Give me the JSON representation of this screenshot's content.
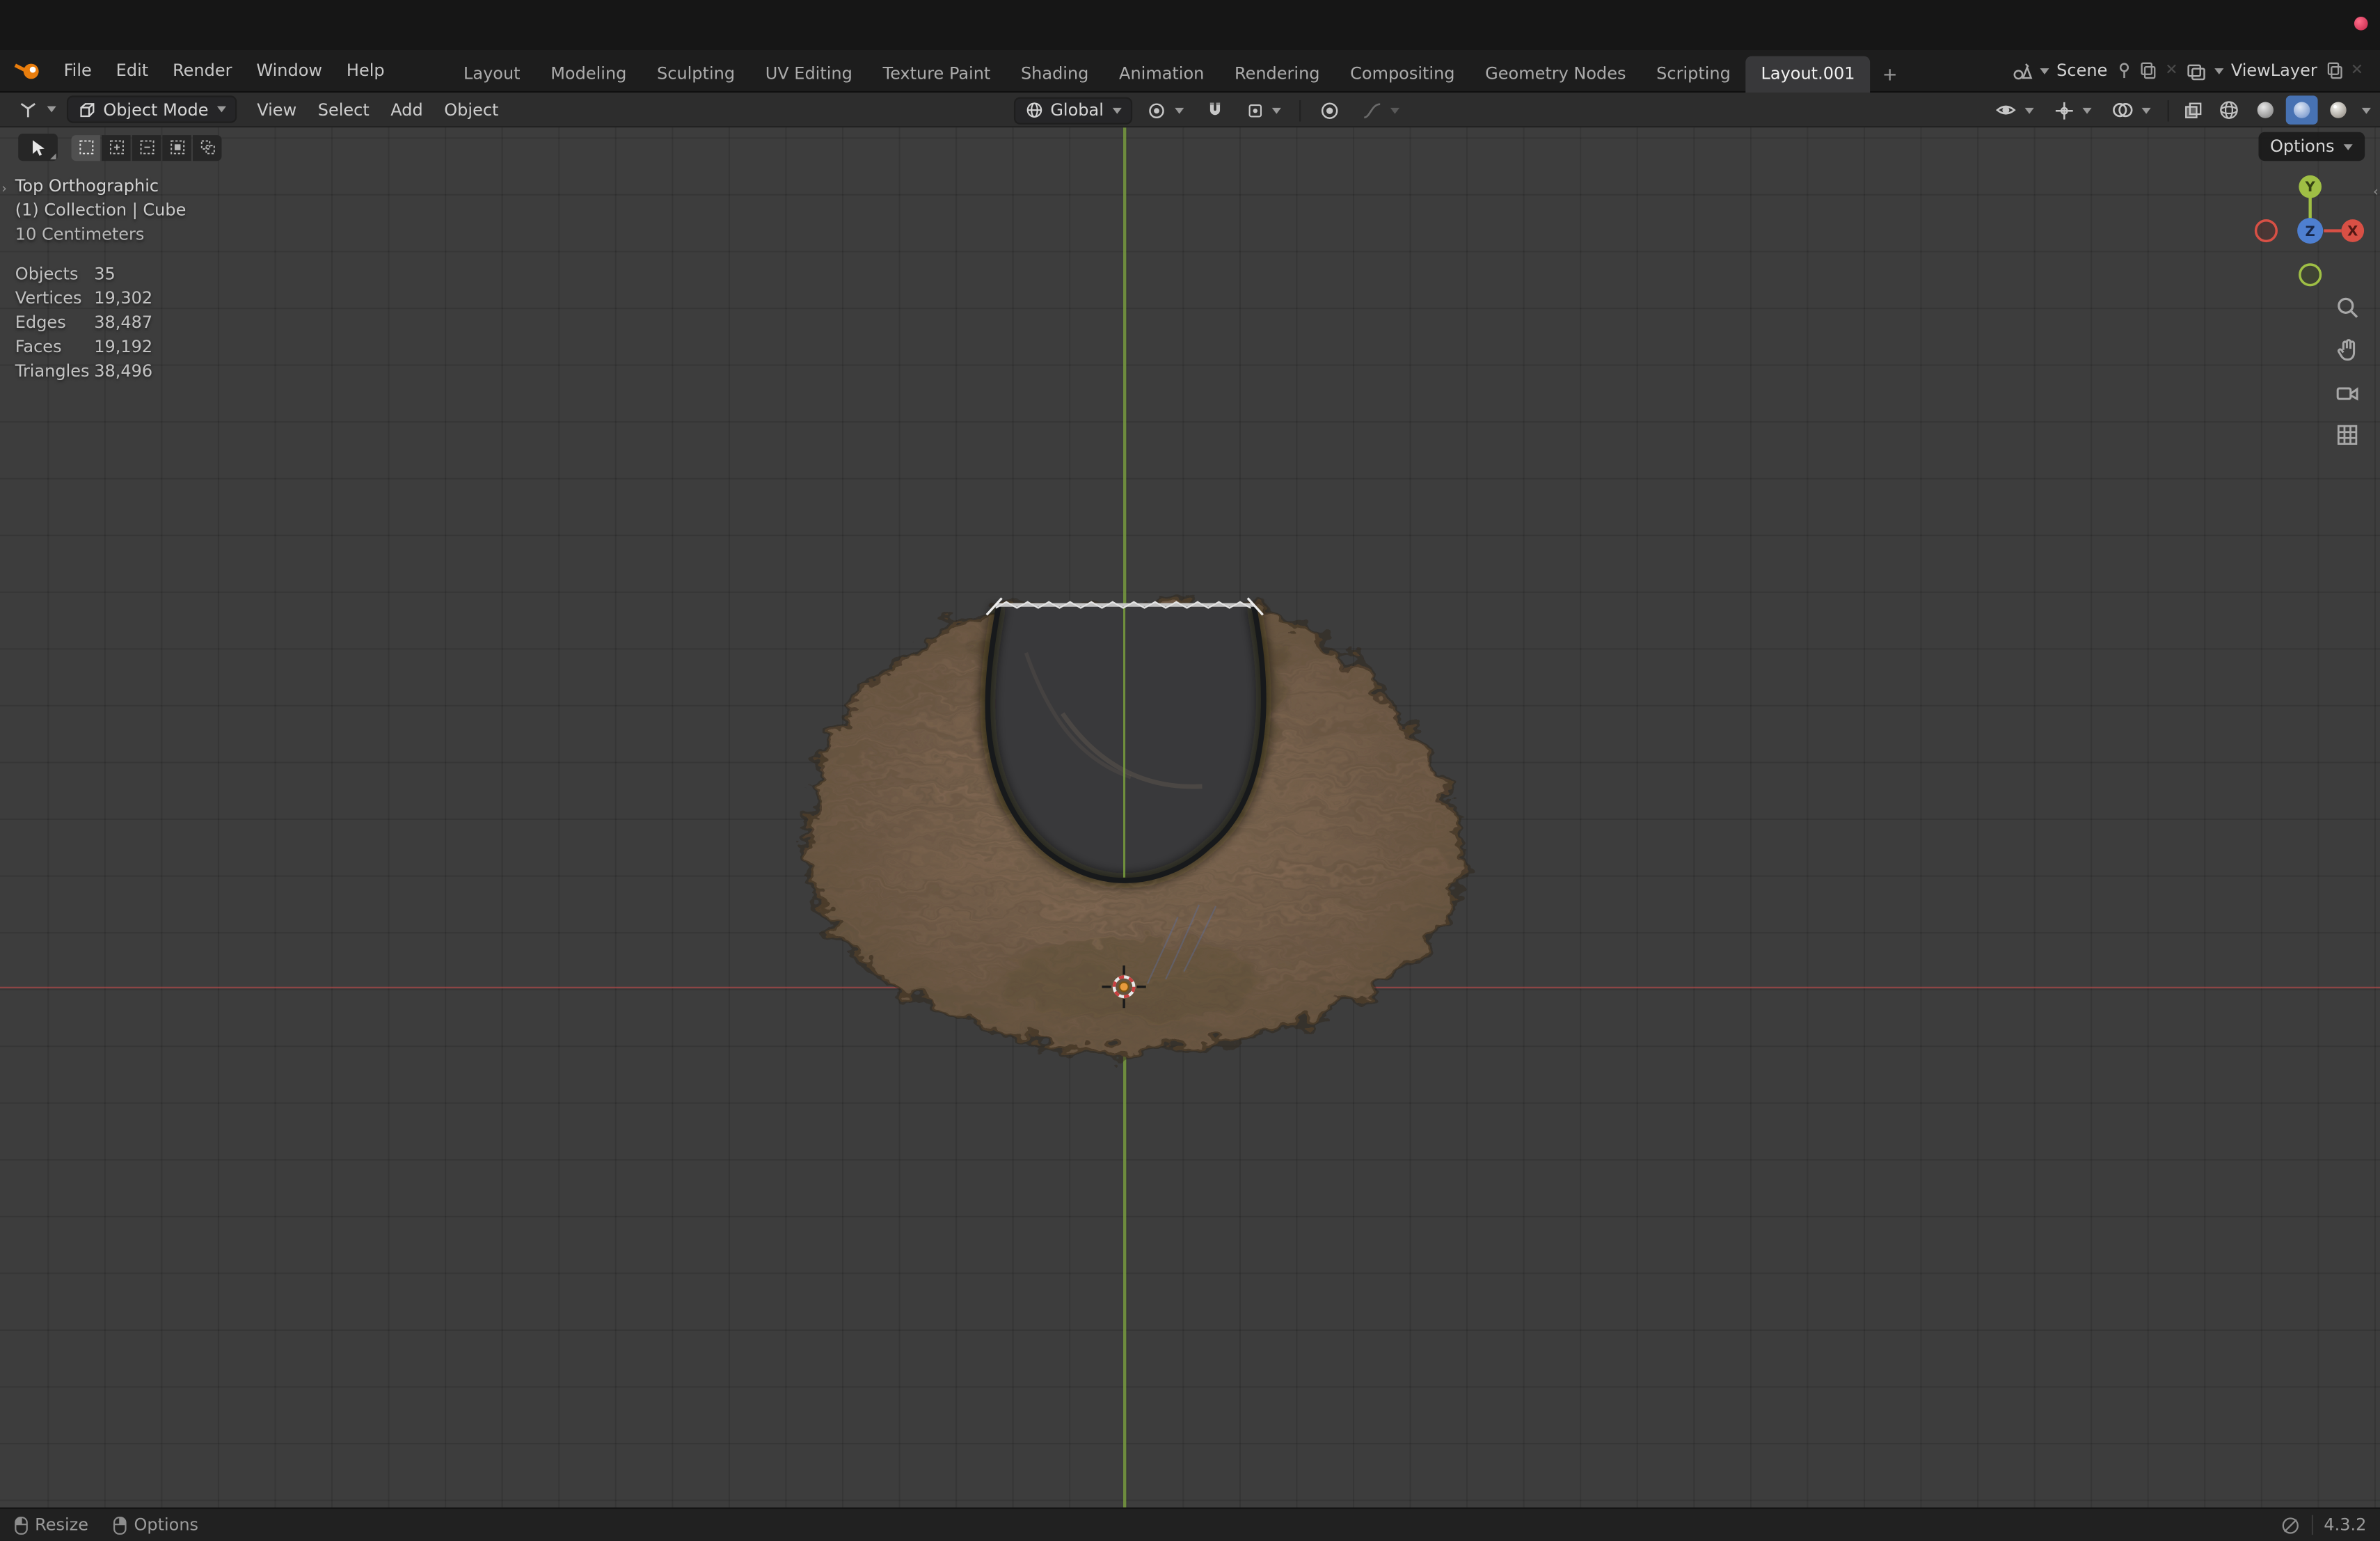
{
  "topbar": {
    "menus": [
      "File",
      "Edit",
      "Render",
      "Window",
      "Help"
    ],
    "tabs": [
      "Layout",
      "Modeling",
      "Sculpting",
      "UV Editing",
      "Texture Paint",
      "Shading",
      "Animation",
      "Rendering",
      "Compositing",
      "Geometry Nodes",
      "Scripting",
      "Layout.001"
    ],
    "active_tab": "Layout.001",
    "new_tab_label": "+",
    "scene_label": "Scene",
    "viewlayer_label": "ViewLayer"
  },
  "viewport_header": {
    "mode_label": "Object Mode",
    "menus": [
      "View",
      "Select",
      "Add",
      "Object"
    ],
    "orientation_label": "Global",
    "options_label": "Options"
  },
  "viewport_overlay": {
    "view_label": "Top Orthographic",
    "context_label": "(1) Collection | Cube",
    "scale_label": "10 Centimeters",
    "stats": [
      {
        "label": "Objects",
        "value": "35"
      },
      {
        "label": "Vertices",
        "value": "19,302"
      },
      {
        "label": "Edges",
        "value": "38,487"
      },
      {
        "label": "Faces",
        "value": "19,192"
      },
      {
        "label": "Triangles",
        "value": "38,496"
      }
    ],
    "axis_labels": {
      "x": "X",
      "y": "Y",
      "z": "Z"
    }
  },
  "statusbar": {
    "left_items": [
      {
        "label": "Resize"
      },
      {
        "label": "Options"
      }
    ],
    "version": "4.3.2"
  },
  "colors": {
    "accent_blue": "#4772b3",
    "axis_green": "#7aa03e",
    "axis_red": "#aa4848",
    "fur_base": "#8a6d58"
  }
}
